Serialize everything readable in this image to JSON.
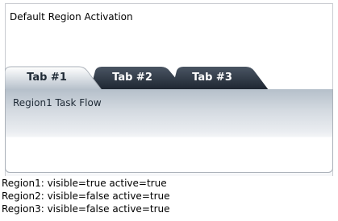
{
  "panel": {
    "title": "Default Region Activation"
  },
  "tabs": [
    {
      "label": "Tab #1",
      "state": "active"
    },
    {
      "label": "Tab #2",
      "state": "inactive"
    },
    {
      "label": "Tab #3",
      "state": "inactive"
    }
  ],
  "content": {
    "text": "Region1 Task Flow"
  },
  "status": [
    "Region1: visible=true active=true",
    "Region2: visible=false active=true",
    "Region3: visible=false active=true"
  ],
  "colors": {
    "tab_active_top": "#ffffff",
    "tab_active_bottom": "#b5bfca",
    "tab_inactive_top": "#4a5563",
    "tab_inactive_bottom": "#1d2530",
    "active_label": "#1f2a36",
    "inactive_label": "#ffffff"
  }
}
